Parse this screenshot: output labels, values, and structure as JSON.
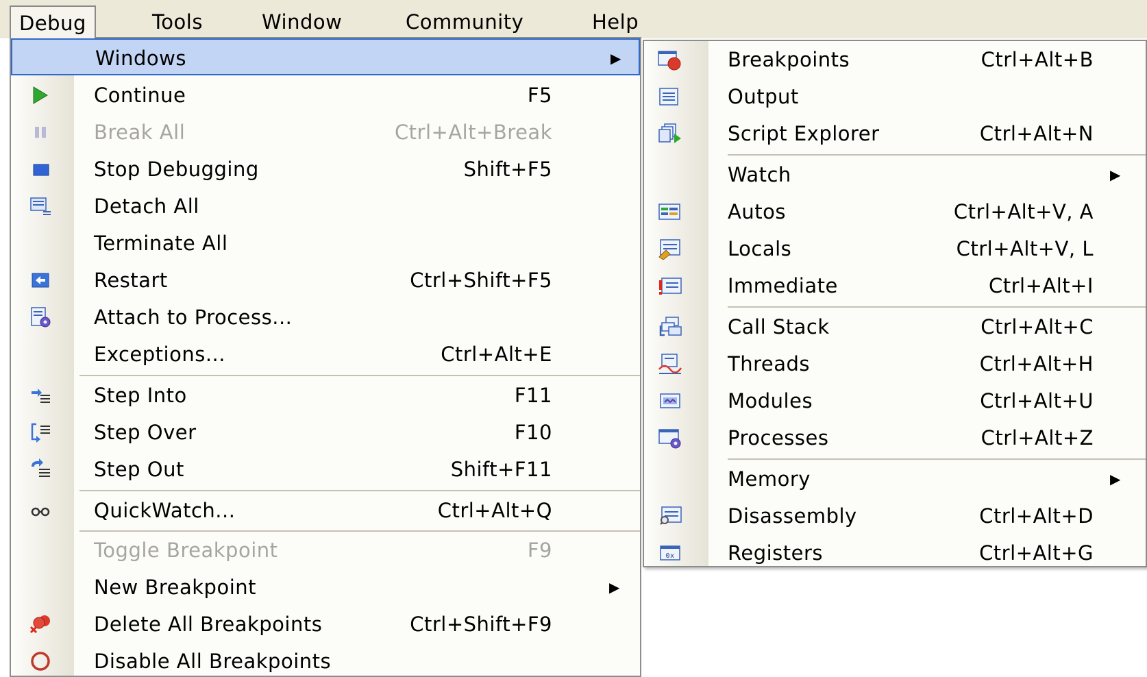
{
  "menubar": {
    "items": [
      "Debug",
      "Tools",
      "Window",
      "Community",
      "Help"
    ],
    "open_item": "Debug"
  },
  "debug_menu": {
    "items": [
      {
        "label": "Windows",
        "shortcut": "",
        "submenu": true,
        "highlighted": true,
        "icon": ""
      },
      {
        "label": "Continue",
        "shortcut": "F5",
        "icon": "continue-icon"
      },
      {
        "label": "Break All",
        "shortcut": "Ctrl+Alt+Break",
        "disabled": true,
        "icon": "break-all-icon"
      },
      {
        "label": "Stop Debugging",
        "shortcut": "Shift+F5",
        "icon": "stop-debugging-icon"
      },
      {
        "label": "Detach All",
        "shortcut": "",
        "icon": "detach-all-icon"
      },
      {
        "label": "Terminate All",
        "shortcut": "",
        "icon": ""
      },
      {
        "label": "Restart",
        "shortcut": "Ctrl+Shift+F5",
        "icon": "restart-icon"
      },
      {
        "label": "Attach to Process...",
        "shortcut": "",
        "icon": "attach-to-process-icon"
      },
      {
        "label": "Exceptions...",
        "shortcut": "Ctrl+Alt+E",
        "icon": ""
      },
      {
        "label": "Step Into",
        "shortcut": "F11",
        "icon": "step-into-icon"
      },
      {
        "label": "Step Over",
        "shortcut": "F10",
        "icon": "step-over-icon"
      },
      {
        "label": "Step Out",
        "shortcut": "Shift+F11",
        "icon": "step-out-icon"
      },
      {
        "label": "QuickWatch...",
        "shortcut": "Ctrl+Alt+Q",
        "icon": "quickwatch-icon"
      },
      {
        "label": "Toggle Breakpoint",
        "shortcut": "F9",
        "disabled": true,
        "icon": ""
      },
      {
        "label": "New Breakpoint",
        "shortcut": "",
        "submenu": true,
        "icon": ""
      },
      {
        "label": "Delete All Breakpoints",
        "shortcut": "Ctrl+Shift+F9",
        "icon": "delete-all-breakpoints-icon"
      },
      {
        "label": "Disable All Breakpoints",
        "shortcut": "",
        "icon": "disable-all-breakpoints-icon"
      }
    ]
  },
  "windows_submenu": {
    "items": [
      {
        "label": "Breakpoints",
        "shortcut": "Ctrl+Alt+B",
        "icon": "breakpoints-icon"
      },
      {
        "label": "Output",
        "shortcut": "",
        "icon": "output-icon"
      },
      {
        "label": "Script Explorer",
        "shortcut": "Ctrl+Alt+N",
        "icon": "script-explorer-icon"
      },
      {
        "label": "Watch",
        "shortcut": "",
        "submenu": true,
        "icon": ""
      },
      {
        "label": "Autos",
        "shortcut": "Ctrl+Alt+V, A",
        "icon": "autos-icon"
      },
      {
        "label": "Locals",
        "shortcut": "Ctrl+Alt+V, L",
        "icon": "locals-icon"
      },
      {
        "label": "Immediate",
        "shortcut": "Ctrl+Alt+I",
        "icon": "immediate-icon"
      },
      {
        "label": "Call Stack",
        "shortcut": "Ctrl+Alt+C",
        "icon": "call-stack-icon"
      },
      {
        "label": "Threads",
        "shortcut": "Ctrl+Alt+H",
        "icon": "threads-icon"
      },
      {
        "label": "Modules",
        "shortcut": "Ctrl+Alt+U",
        "icon": "modules-icon"
      },
      {
        "label": "Processes",
        "shortcut": "Ctrl+Alt+Z",
        "icon": "processes-icon"
      },
      {
        "label": "Memory",
        "shortcut": "",
        "submenu": true,
        "icon": ""
      },
      {
        "label": "Disassembly",
        "shortcut": "Ctrl+Alt+D",
        "icon": "disassembly-icon"
      },
      {
        "label": "Registers",
        "shortcut": "Ctrl+Alt+G",
        "icon": "registers-icon"
      }
    ]
  },
  "submenu_arrow": "▶",
  "colors": {
    "menubar": "#ece9d8",
    "highlight_fill": "#c2d5f4",
    "highlight_border": "#316ac5",
    "disabled_text": "#a6a59f",
    "breakpoint_red": "#d93a2b"
  }
}
